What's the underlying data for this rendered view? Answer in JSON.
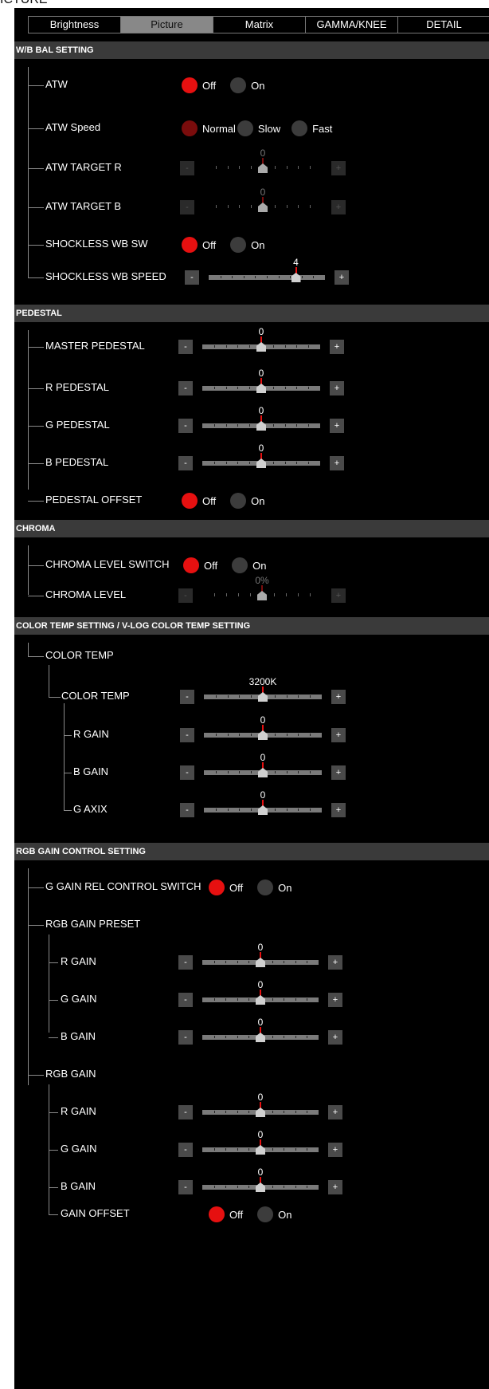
{
  "page_label": "ICTURE",
  "tabs": [
    {
      "label": "Brightness",
      "active": false
    },
    {
      "label": "Picture",
      "active": true
    },
    {
      "label": "Matrix",
      "active": false
    },
    {
      "label": "GAMMA/KNEE",
      "active": false
    },
    {
      "label": "DETAIL",
      "active": false
    }
  ],
  "sections": {
    "wb": "W/B BAL SETTING",
    "pedestal": "PEDESTAL",
    "chroma": "CHROMA",
    "colortemp": "COLOR TEMP SETTING / V-LOG COLOR TEMP SETTING",
    "rgbgain": "RGB GAIN CONTROL SETTING"
  },
  "radio_labels": {
    "off": "Off",
    "on": "On",
    "normal": "Normal",
    "slow": "Slow",
    "fast": "Fast"
  },
  "slider_buttons": {
    "minus": "-",
    "plus": "+"
  },
  "colors": {
    "accent_red": "#e61010",
    "section_bg": "#3a3a3a",
    "panel_bg": "#000000"
  },
  "settings": {
    "atw": {
      "label": "ATW",
      "value": "Off"
    },
    "atw_speed": {
      "label": "ATW Speed",
      "value": "Normal"
    },
    "atw_target_r": {
      "label": "ATW TARGET R",
      "value": "0",
      "position": 0.5,
      "disabled": true
    },
    "atw_target_b": {
      "label": "ATW TARGET B",
      "value": "0",
      "position": 0.5,
      "disabled": true
    },
    "shockless_wb_sw": {
      "label": "SHOCKLESS WB SW",
      "value": "Off"
    },
    "shockless_wb_speed": {
      "label": "SHOCKLESS WB SPEED",
      "value": "4",
      "position": 0.75
    },
    "master_pedestal": {
      "label": "MASTER PEDESTAL",
      "value": "0",
      "position": 0.5
    },
    "r_pedestal": {
      "label": "R PEDESTAL",
      "value": "0",
      "position": 0.5
    },
    "g_pedestal": {
      "label": "G PEDESTAL",
      "value": "0",
      "position": 0.5
    },
    "b_pedestal": {
      "label": "B PEDESTAL",
      "value": "0",
      "position": 0.5
    },
    "pedestal_offset": {
      "label": "PEDESTAL OFFSET",
      "value": "Off"
    },
    "chroma_level_switch": {
      "label": "CHROMA LEVEL SWITCH",
      "value": "Off"
    },
    "chroma_level": {
      "label": "CHROMA LEVEL",
      "value": "0%",
      "position": 0.5,
      "disabled": true
    },
    "color_temp_group": {
      "label": "COLOR TEMP"
    },
    "color_temp": {
      "label": "COLOR TEMP",
      "value": "3200K",
      "position": 0.5
    },
    "ct_r_gain": {
      "label": "R GAIN",
      "value": "0",
      "position": 0.5
    },
    "ct_b_gain": {
      "label": "B GAIN",
      "value": "0",
      "position": 0.5
    },
    "ct_g_axix": {
      "label": "G AXIX",
      "value": "0",
      "position": 0.5
    },
    "g_gain_rel_switch": {
      "label": "G GAIN REL CONTROL SWITCH",
      "value": "Off"
    },
    "rgb_gain_preset": {
      "label": "RGB GAIN PRESET"
    },
    "preset_r_gain": {
      "label": "R GAIN",
      "value": "0",
      "position": 0.5
    },
    "preset_g_gain": {
      "label": "G GAIN",
      "value": "0",
      "position": 0.5
    },
    "preset_b_gain": {
      "label": "B GAIN",
      "value": "0",
      "position": 0.5
    },
    "rgb_gain": {
      "label": "RGB GAIN"
    },
    "rgb_r_gain": {
      "label": "R GAIN",
      "value": "0",
      "position": 0.5
    },
    "rgb_g_gain": {
      "label": "G GAIN",
      "value": "0",
      "position": 0.5
    },
    "rgb_b_gain": {
      "label": "B GAIN",
      "value": "0",
      "position": 0.5
    },
    "gain_offset": {
      "label": "GAIN OFFSET",
      "value": "Off"
    }
  }
}
